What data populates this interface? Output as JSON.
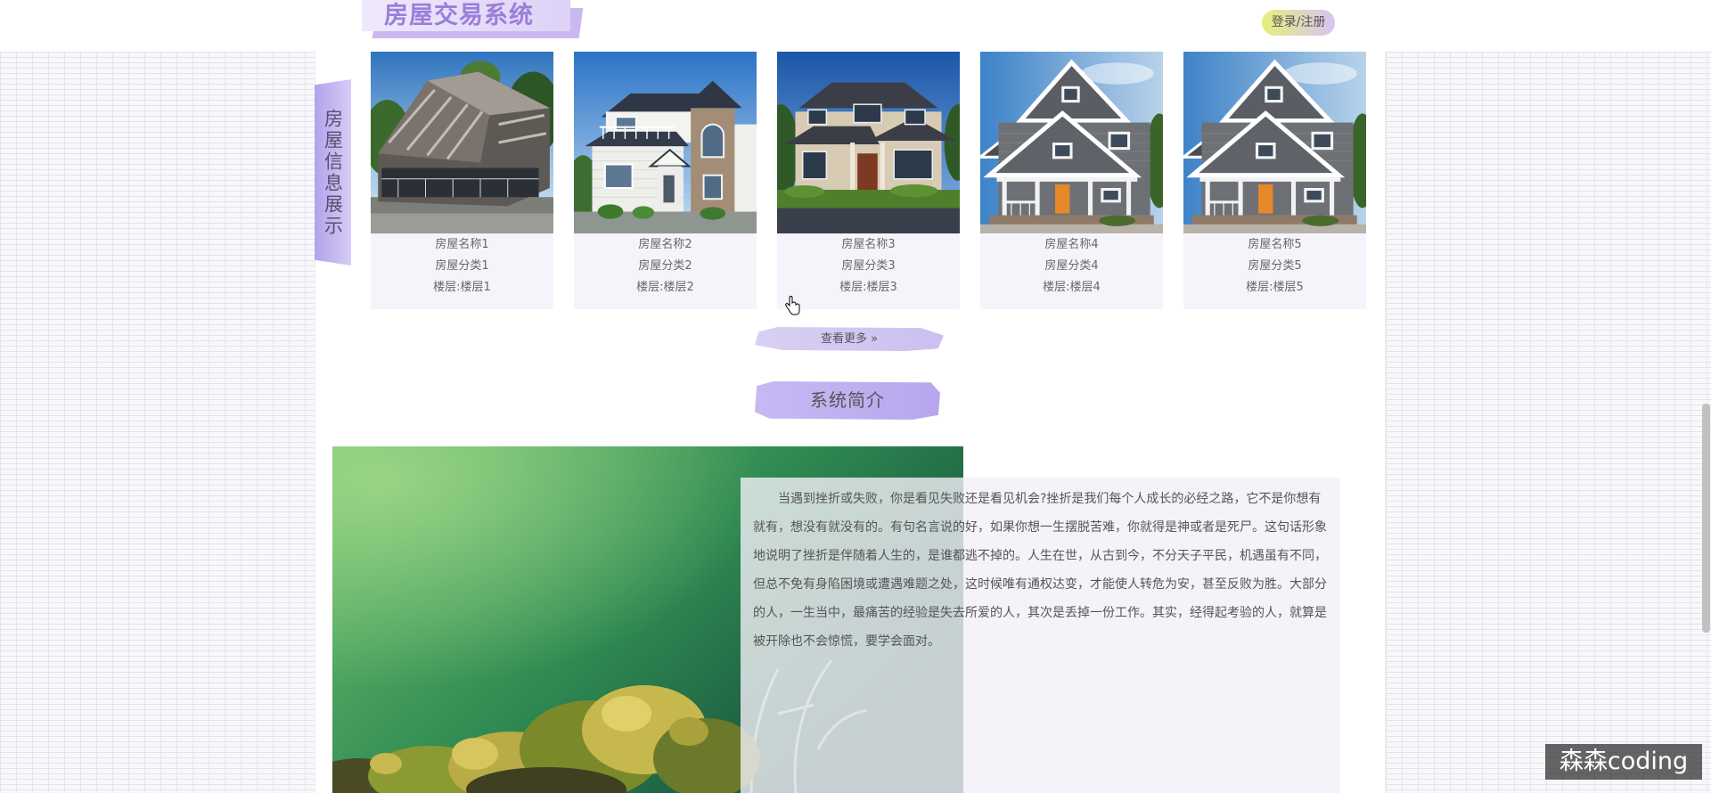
{
  "header": {
    "title": "房屋交易系统",
    "login_register": "登录/注册"
  },
  "side_tab": {
    "label": "房屋信息展示"
  },
  "houses": [
    {
      "name": "房屋名称1",
      "category": "房屋分类1",
      "floor": "楼层:楼层1"
    },
    {
      "name": "房屋名称2",
      "category": "房屋分类2",
      "floor": "楼层:楼层2"
    },
    {
      "name": "房屋名称3",
      "category": "房屋分类3",
      "floor": "楼层:楼层3"
    },
    {
      "name": "房屋名称4",
      "category": "房屋分类4",
      "floor": "楼层:楼层4"
    },
    {
      "name": "房屋名称5",
      "category": "房屋分类5",
      "floor": "楼层:楼层5"
    }
  ],
  "more_button": {
    "label": "查看更多 »"
  },
  "intro": {
    "heading": "系统简介",
    "text": "当遇到挫折或失败，你是看见失败还是看见机会?挫折是我们每个人成长的必经之路，它不是你想有就有，想没有就没有的。有句名言说的好，如果你想一生摆脱苦难，你就得是神或者是死尸。这句话形象地说明了挫折是伴随着人生的，是谁都逃不掉的。人生在世，从古到今，不分天子平民，机遇虽有不同，但总不免有身陷困境或遭遇难题之处，这时候唯有通权达变，才能使人转危为安，甚至反败为胜。大部分的人，一生当中，最痛苦的经验是失去所爱的人，其次是丢掉一份工作。其实，经得起考验的人，就算是被开除也不会惊慌，要学会面对。"
  },
  "watermark": {
    "text": "森森coding"
  },
  "colors": {
    "accent": "#9b7ed9",
    "brush": "#c7baf2",
    "login_gradient_start": "#e7ef7c",
    "login_gradient_end": "#d9c3f2"
  },
  "icons": {
    "cursor": "pointer-hand-icon"
  }
}
